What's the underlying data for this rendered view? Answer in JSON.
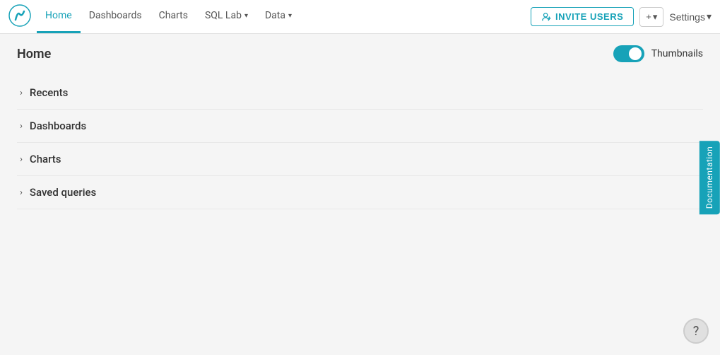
{
  "nav": {
    "logo_alt": "Preset logo",
    "items": [
      {
        "label": "Home",
        "active": true,
        "has_dropdown": false
      },
      {
        "label": "Dashboards",
        "active": false,
        "has_dropdown": false
      },
      {
        "label": "Charts",
        "active": false,
        "has_dropdown": false
      },
      {
        "label": "SQL Lab",
        "active": false,
        "has_dropdown": true
      },
      {
        "label": "Data",
        "active": false,
        "has_dropdown": true
      }
    ],
    "invite_button_label": "INVITE USERS",
    "plus_button_label": "+",
    "settings_label": "Settings"
  },
  "page": {
    "title": "Home",
    "thumbnails_label": "Thumbnails",
    "toggle_on": true
  },
  "sections": [
    {
      "label": "Recents"
    },
    {
      "label": "Dashboards"
    },
    {
      "label": "Charts"
    },
    {
      "label": "Saved queries"
    }
  ],
  "doc_tab": {
    "label": "Documentation"
  },
  "help_icon": "?"
}
